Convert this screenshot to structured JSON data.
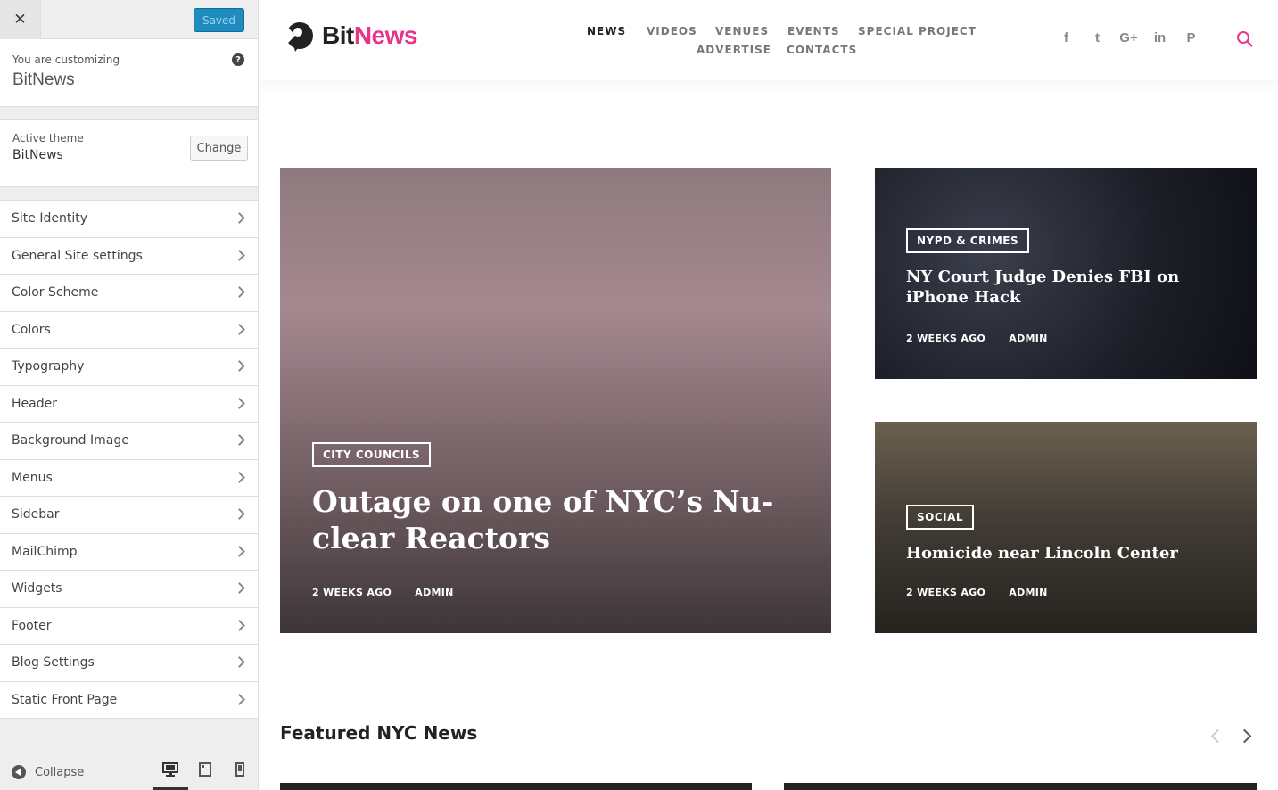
{
  "customizer": {
    "close_symbol": "✕",
    "saved_label": "Saved",
    "customizing_label": "You are customizing",
    "site_title": "BitNews",
    "help_symbol": "?",
    "active_theme_label": "Active theme",
    "active_theme_name": "BitNews",
    "change_label": "Change",
    "sections": [
      {
        "label": "Site Identity"
      },
      {
        "label": "General Site settings"
      },
      {
        "label": "Color Scheme"
      },
      {
        "label": "Colors"
      },
      {
        "label": "Typography"
      },
      {
        "label": "Header"
      },
      {
        "label": "Background Image"
      },
      {
        "label": "Menus"
      },
      {
        "label": "Sidebar"
      },
      {
        "label": "MailChimp"
      },
      {
        "label": "Widgets"
      },
      {
        "label": "Footer"
      },
      {
        "label": "Blog Settings"
      },
      {
        "label": "Static Front Page"
      }
    ],
    "collapse_label": "Collapse",
    "devices": [
      {
        "name": "desktop-icon",
        "active": true
      },
      {
        "name": "tablet-icon",
        "active": false
      },
      {
        "name": "mobile-icon",
        "active": false
      }
    ]
  },
  "site": {
    "logo": {
      "bit": "Bit",
      "news": "News"
    },
    "nav": [
      {
        "label": "NEWS",
        "active": true
      },
      {
        "label": "VIDEOS",
        "active": false
      },
      {
        "label": "VENUES",
        "active": false
      },
      {
        "label": "EVENTS",
        "active": false
      },
      {
        "label": "SPECIAL PROJECT",
        "active": false
      },
      {
        "label": "ADVERTISE",
        "active": false
      },
      {
        "label": "CONTACTS",
        "active": false
      }
    ],
    "socials": [
      {
        "icon": "facebook-icon",
        "glyph": "f"
      },
      {
        "icon": "twitter-icon",
        "glyph": "t"
      },
      {
        "icon": "google-plus-icon",
        "glyph": "G+"
      },
      {
        "icon": "linkedin-icon",
        "glyph": "in"
      },
      {
        "icon": "pinterest-icon",
        "glyph": "P"
      }
    ],
    "accent_color": "#e9348b",
    "posts": {
      "main": {
        "category": "CITY COUNCILS",
        "title": "Outage on one of NYC’s Nu-clear Reactors",
        "date": "2 WEEKS AGO",
        "author": "ADMIN"
      },
      "side_a": {
        "category": "NYPD & CRIMES",
        "title": "NY Court Judge Denies FBI on iPhone Hack",
        "date": "2 WEEKS AGO",
        "author": "ADMIN"
      },
      "side_b": {
        "category": "SOCIAL",
        "title": "Homicide near Lincoln Center",
        "date": "2 WEEKS AGO",
        "author": "ADMIN"
      }
    },
    "featured_title": "Featured NYC News"
  }
}
